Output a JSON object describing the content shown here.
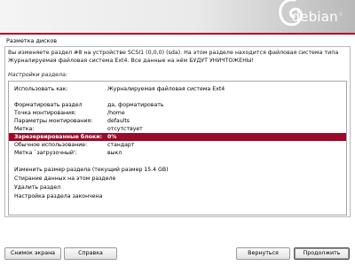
{
  "header": {
    "brand": "debian",
    "brand_mark": "®"
  },
  "page_title": "Разметка дисков",
  "info_text": "Вы изменяете раздел #8 на устройстве SCSI1 (0,0,0) (sda). На этом разделе находится файловая система типа Журналируемая файловая система Ext4. Все данные на нём БУДУТ УНИЧТОЖЕНЫ!",
  "settings_label": "Настройки раздела:",
  "rows": [
    {
      "key": "Использовать как:",
      "value": "Журналируемая файловая система Ext4"
    },
    {
      "key": "",
      "value": ""
    },
    {
      "key": "Форматировать раздел",
      "value": "да, форматировать"
    },
    {
      "key": "Точка монтирования:",
      "value": "/home"
    },
    {
      "key": "Параметры монтирования:",
      "value": "defaults"
    },
    {
      "key": "Метка:",
      "value": "отсутствует"
    },
    {
      "key": "Зарезервированные блоки:",
      "value": "0%"
    },
    {
      "key": "Обычное использование:",
      "value": "стандарт"
    },
    {
      "key": "Метка `загрузочный':",
      "value": "выкл"
    },
    {
      "key": "",
      "value": ""
    },
    {
      "key": "Изменить размер раздела (текущий размер 15.4 GB)",
      "value": ""
    },
    {
      "key": "Стирание данных на этом разделе",
      "value": ""
    },
    {
      "key": "Удалить раздел",
      "value": ""
    },
    {
      "key": "Настройка раздела закончена",
      "value": ""
    }
  ],
  "selected_row": 6,
  "buttons": {
    "screenshot": "Снимок экрана",
    "help": "Справка",
    "back": "Вернуться",
    "continue": "Продолжить"
  }
}
